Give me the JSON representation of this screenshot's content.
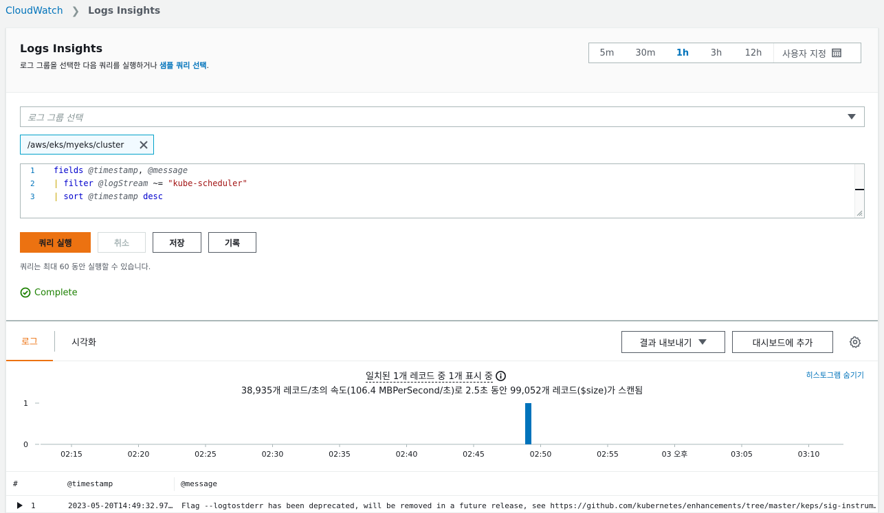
{
  "breadcrumb": {
    "root": "CloudWatch",
    "current": "Logs Insights"
  },
  "header": {
    "title": "Logs Insights",
    "desc_prefix": "로그 그룹을 선택한 다음 쿼리를 실행하거나 ",
    "desc_link": "샘플 쿼리 선택",
    "desc_suffix": "."
  },
  "time_range": {
    "options": [
      "5m",
      "30m",
      "1h",
      "3h",
      "12h"
    ],
    "active": "1h",
    "custom_label": "사용자 지정"
  },
  "log_group": {
    "placeholder": "로그 그룹 선택",
    "selected": "/aws/eks/myeks/cluster"
  },
  "query_editor": {
    "line_numbers": [
      "1",
      "2",
      "3"
    ]
  },
  "buttons": {
    "run": "쿼리 실행",
    "cancel": "취소",
    "save": "저장",
    "history": "기록"
  },
  "hint": "쿼리는 최대 60 동안 실행할 수 있습니다.",
  "status": "Complete",
  "colors": {
    "accent": "#ec7211",
    "link": "#0073bb",
    "success": "#1d8102",
    "bar": "#0073bb"
  },
  "tabs": {
    "logs": "로그",
    "viz": "시각화"
  },
  "actions": {
    "export": "결과 내보내기",
    "add_dashboard": "대시보드에 추가"
  },
  "results": {
    "summary": "일치된 1개 레코드 중 1개 표시 중",
    "scan_info": "38,935개 레코드/초의 속도(106.4 MBPerSecond/초)로 2.5초 동안 99,052개 레코드($size)가 스캔됨",
    "hide_histogram": "히스토그램 숨기기"
  },
  "chart_data": {
    "type": "bar",
    "x_ticks": [
      "02:15",
      "02:20",
      "02:25",
      "02:30",
      "02:35",
      "02:40",
      "02:45",
      "02:50",
      "02:55",
      "03 오후",
      "03:05",
      "03:10"
    ],
    "y_ticks": [
      "0",
      "1"
    ],
    "ylim": [
      0,
      1
    ],
    "bars": [
      {
        "x": "02:49",
        "value": 1
      }
    ]
  },
  "table": {
    "columns": [
      "#",
      "@timestamp",
      "@message"
    ],
    "rows": [
      {
        "num": "1",
        "timestamp": "2023-05-20T14:49:32.97…",
        "message": "Flag --logtostderr has been deprecated, will be removed in a future release, see https://github.com/kubernetes/enhancements/tree/master/keps/sig-instrum…"
      }
    ]
  }
}
